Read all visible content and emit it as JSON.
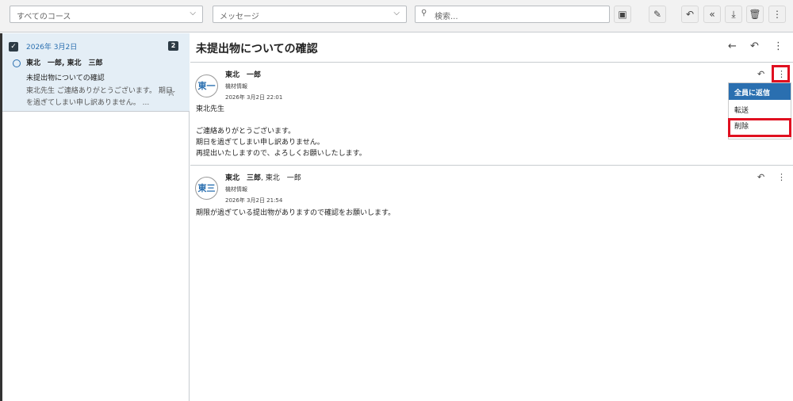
{
  "toolbar": {
    "course_select": "すべてのコース",
    "type_select": "メッセージ",
    "search_placeholder": "検索..."
  },
  "conversation_list": [
    {
      "date": "2026年 3月2日",
      "count": "2",
      "participants": "東北　一郎, 東北　三郎",
      "subject": "未提出物についての確認",
      "preview_line1": "東北先生 ご連絡ありがとうございます。 期日",
      "preview_line2": "を過ぎてしまい申し訳ありません。 ..."
    }
  ],
  "conversation": {
    "title": "未提出物についての確認",
    "messages": [
      {
        "avatar": "東一",
        "sender": "東北　一郎",
        "course": "機材情報",
        "timestamp": "2026年 3月2日 22:01",
        "body": [
          "東北先生",
          "",
          "ご連絡ありがとうございます。",
          "期日を過ぎてしまい申し訳ありません。",
          "再提出いたしますので、よろしくお願いしたします。"
        ]
      },
      {
        "avatar": "東三",
        "sender": "東北　三郎",
        "recipients": ", 東北　一郎",
        "course": "機材情報",
        "timestamp": "2026年 3月2日 21:54",
        "body": [
          "期限が過ぎている提出物がありますので確認をお願いします。"
        ]
      }
    ]
  },
  "menu": {
    "items": [
      "全員に返信",
      "転送",
      "削除"
    ]
  },
  "colors": {
    "accent": "#2a6fb0",
    "highlight": "#e01020",
    "selected_bg": "#e4eef6"
  }
}
